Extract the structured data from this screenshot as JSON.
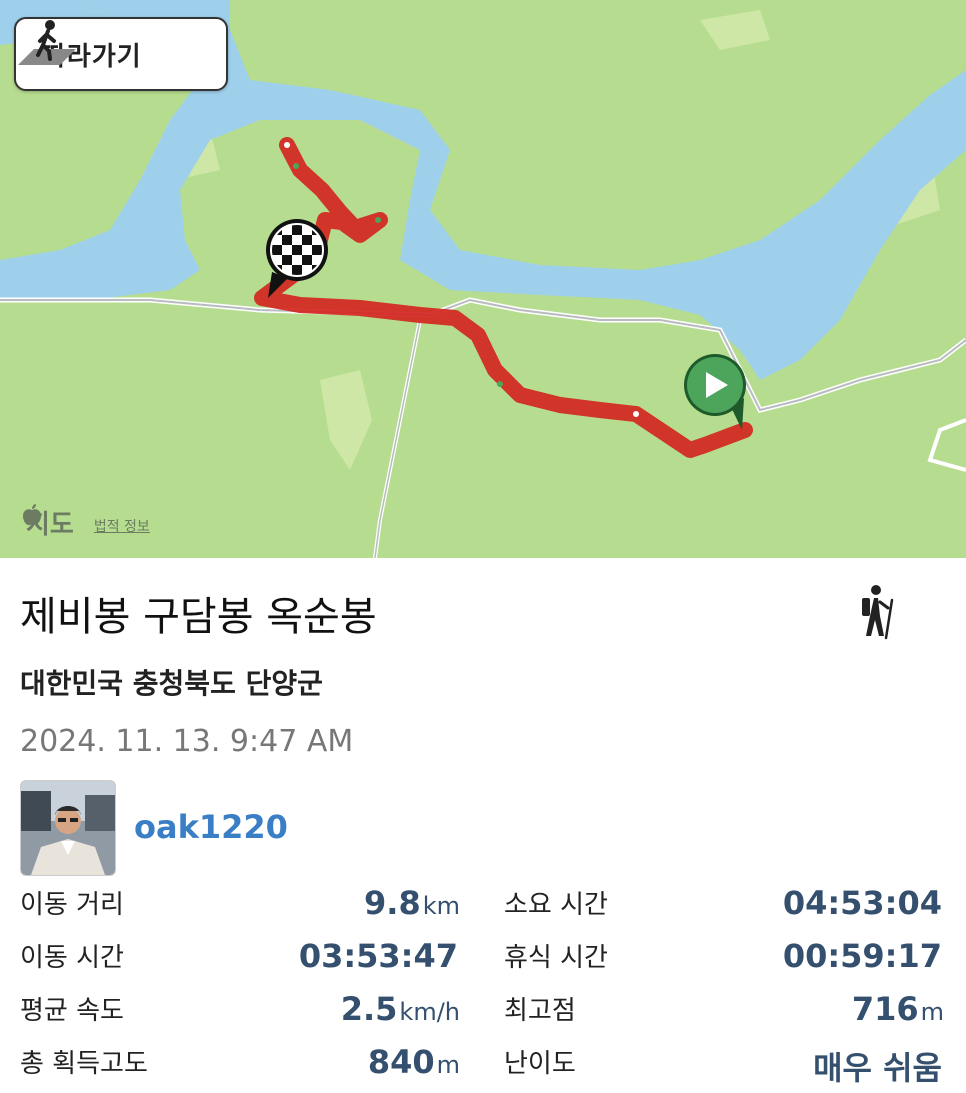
{
  "map": {
    "follow_label": "따라가기",
    "brand_label": "지도",
    "legal_label": "법적 정보",
    "colors": {
      "land": "#b6dd8f",
      "water": "#9ed0ec",
      "route": "#d4251f",
      "start_marker": "#4ca55b"
    }
  },
  "activity": {
    "title": "제비봉 구담봉 옥순봉",
    "location": "대한민국 충청북도 단양군",
    "datetime": "2024. 11. 13. 9:47 AM",
    "type_icon": "hiking-icon"
  },
  "user": {
    "username": "oak1220"
  },
  "stats": [
    {
      "left": {
        "label": "이동 거리",
        "value": "9.8",
        "unit": "km"
      },
      "right": {
        "label": "소요 시간",
        "value": "04:53:04",
        "unit": ""
      }
    },
    {
      "left": {
        "label": "이동 시간",
        "value": "03:53:47",
        "unit": ""
      },
      "right": {
        "label": "휴식 시간",
        "value": "00:59:17",
        "unit": ""
      }
    },
    {
      "left": {
        "label": "평균 속도",
        "value": "2.5",
        "unit": "km/h"
      },
      "right": {
        "label": "최고점",
        "value": "716",
        "unit": "m"
      }
    },
    {
      "left": {
        "label": "총 획득고도",
        "value": "840",
        "unit": "m"
      },
      "right": {
        "label": "난이도",
        "value": "매우 쉬움",
        "unit": ""
      }
    }
  ]
}
